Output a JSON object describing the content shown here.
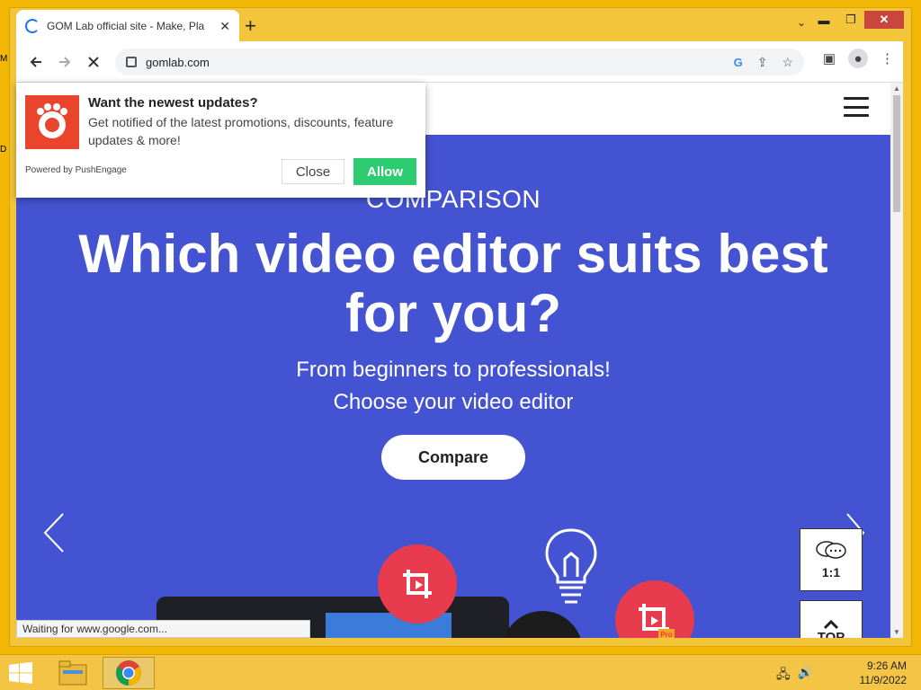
{
  "browser": {
    "tab_title": "GOM Lab official site - Make, Pla",
    "tab_close_glyph": "✕",
    "new_tab_glyph": "+",
    "tab_menu_glyph": "⌄",
    "url": "gomlab.com",
    "google_glyph": "G",
    "status_text": "Waiting for www.google.com..."
  },
  "window_controls": {
    "minimize": "▬",
    "maximize": "❐",
    "close": "✕"
  },
  "desktop_labels": [
    "M",
    "D"
  ],
  "push": {
    "title": "Want the newest updates?",
    "body": "Get notified of the latest promotions, discounts, feature updates & more!",
    "powered_by": "Powered by PushEngage",
    "close_label": "Close",
    "allow_label": "Allow"
  },
  "hero": {
    "overline": "COMPARISON",
    "headline_line1": "Which video editor suits best",
    "headline_line2": "for you?",
    "sub_line1": "From beginners to professionals!",
    "sub_line2": "Choose your video editor",
    "cta_label": "Compare",
    "pro_badge": "Pro"
  },
  "widgets": {
    "chat_label": "1:1",
    "top_label": "TOP"
  },
  "taskbar": {
    "time": "9:26 AM",
    "date": "11/9/2022"
  },
  "colors": {
    "hero_bg": "#4453d1",
    "allow_green": "#2ecc71",
    "brand_red": "#e8452c",
    "desktop_yellow": "#f2b705"
  }
}
